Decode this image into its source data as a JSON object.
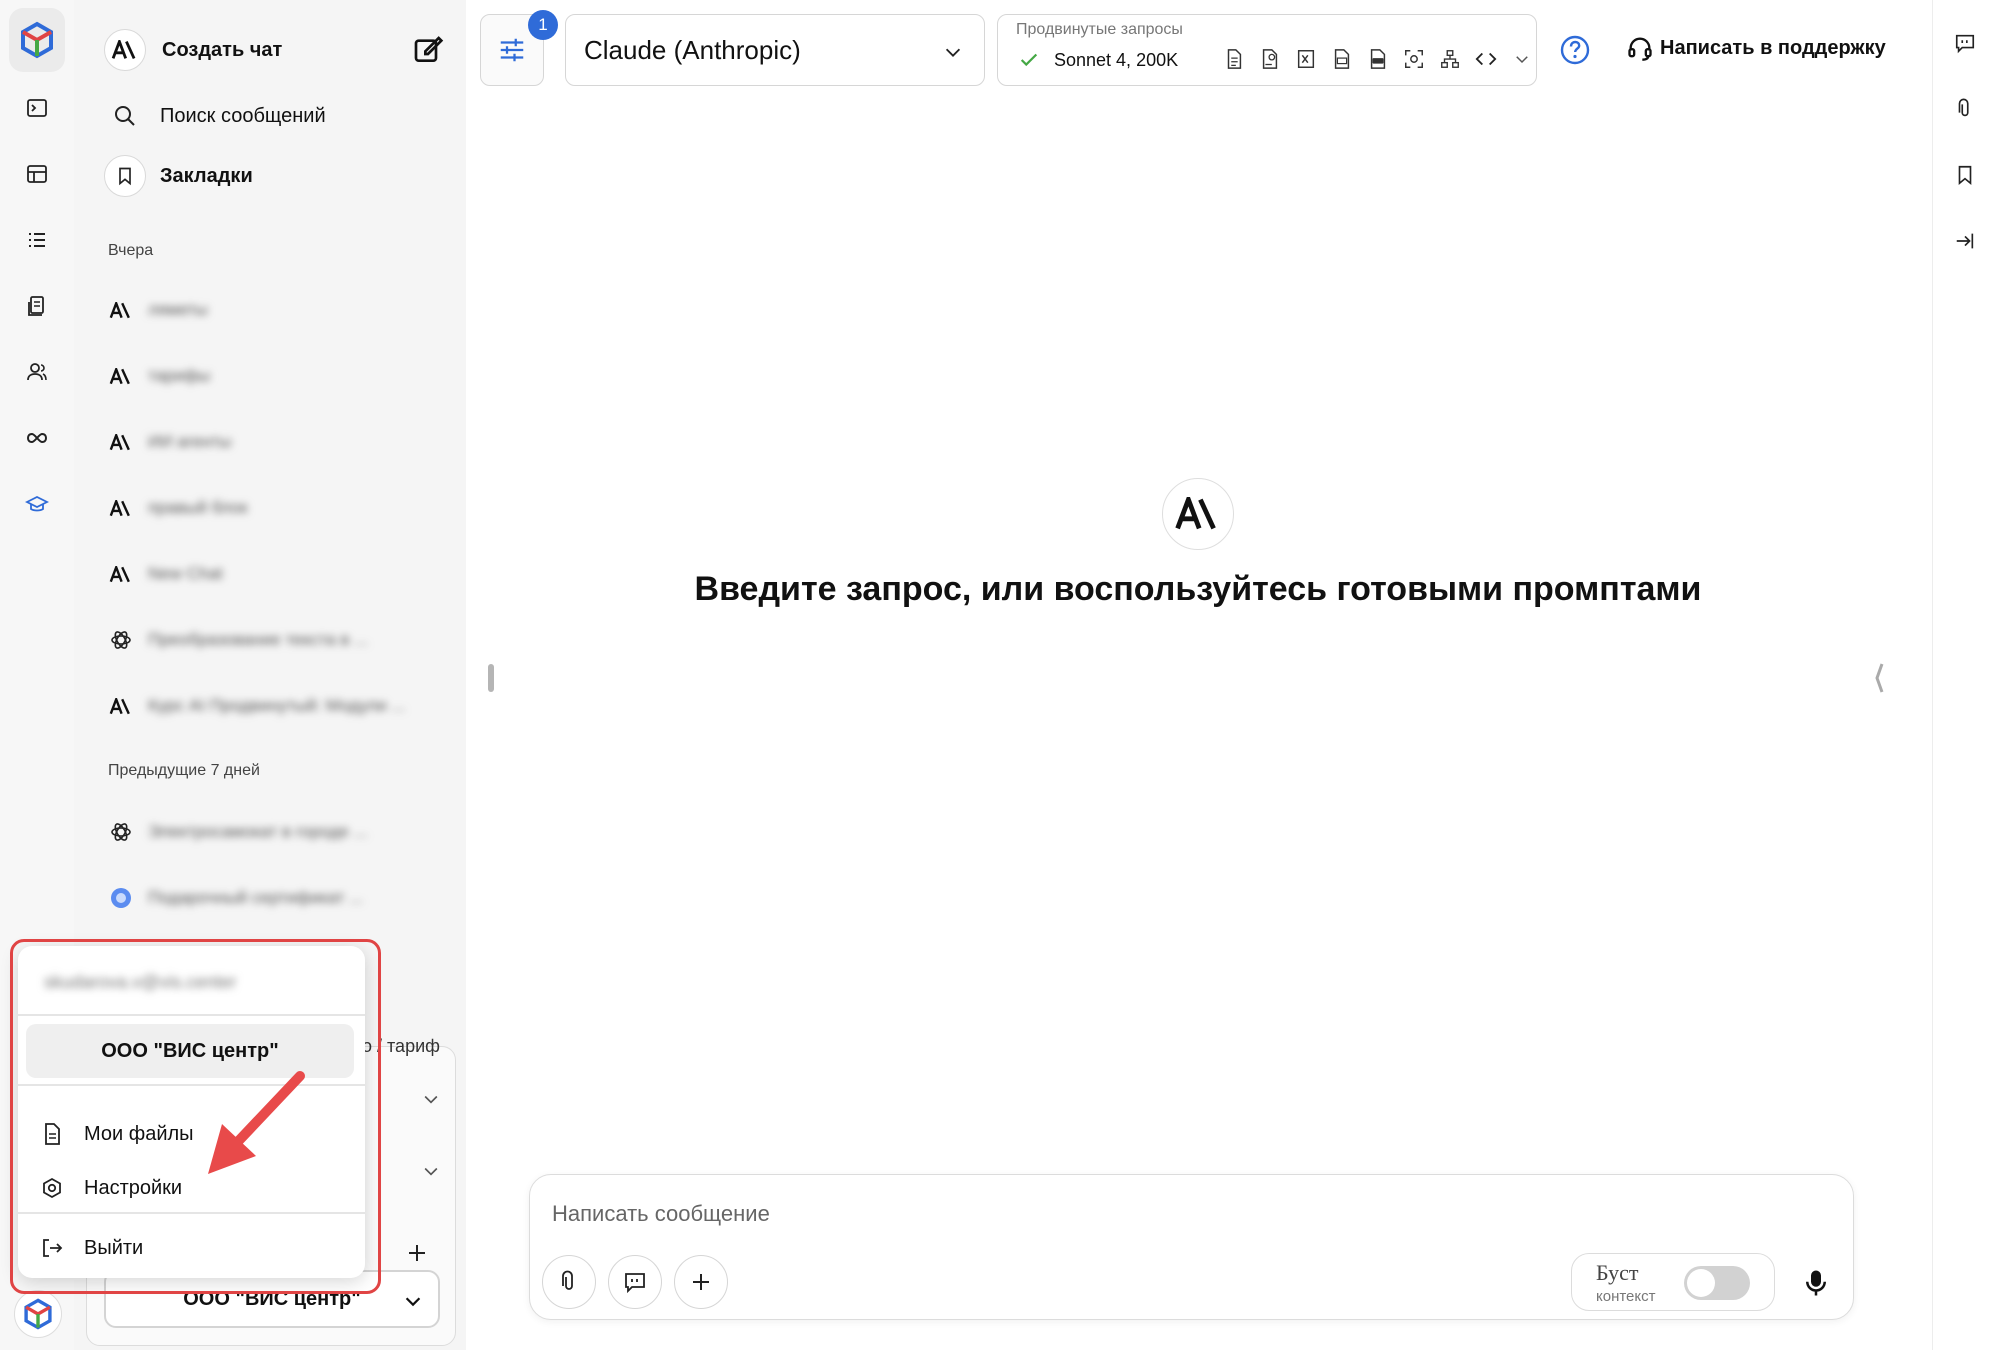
{
  "sidebar": {
    "new_chat_label": "Создать чат",
    "search_label": "Поиск сообщений",
    "bookmarks_label": "Закладки",
    "section_yesterday": "Вчера",
    "section_prev7": "Предыдущие 7 дней",
    "chats_yesterday": [
      {
        "icon": "anthropic-icon",
        "title": "ляметы"
      },
      {
        "icon": "anthropic-icon",
        "title": "тарифы"
      },
      {
        "icon": "anthropic-icon",
        "title": "ИИ агенты"
      },
      {
        "icon": "anthropic-icon",
        "title": "правый блок"
      },
      {
        "icon": "anthropic-icon",
        "title": "New Chat"
      },
      {
        "icon": "openai-icon",
        "title": "Преобразование текста в ..."
      },
      {
        "icon": "anthropic-icon",
        "title": "Курс AI Продвинутый: Модули ..."
      }
    ],
    "chats_prev7": [
      {
        "icon": "openai-icon",
        "title": "Электросамокат в городе ..."
      },
      {
        "icon": "blue-circle-icon",
        "title": "Подарочный сертификат ..."
      }
    ],
    "bg_tariff_text": "о / тариф",
    "bg_org_label": "ООО \"ВИС центр\""
  },
  "popup": {
    "email": "skudarova.v@vis.center",
    "org_label": "ООО \"ВИС центр\"",
    "my_files_label": "Мои файлы",
    "settings_label": "Настройки",
    "logout_label": "Выйти"
  },
  "topbar": {
    "filter_badge": "1",
    "model_label": "Claude (Anthropic)",
    "advanced_caption": "Продвинутые запросы",
    "advanced_value": "Sonnet 4, 200K",
    "support_label": "Написать в поддержку"
  },
  "main": {
    "hero_text": "Введите запрос, или воспользуйтесь готовыми промптами"
  },
  "composer": {
    "placeholder": "Написать сообщение",
    "boost_title": "Буст",
    "boost_sub": "контекст",
    "boost_on": false
  },
  "colors": {
    "accent": "#2f6bd8",
    "highlight": "#e04444",
    "check": "#45a845"
  }
}
